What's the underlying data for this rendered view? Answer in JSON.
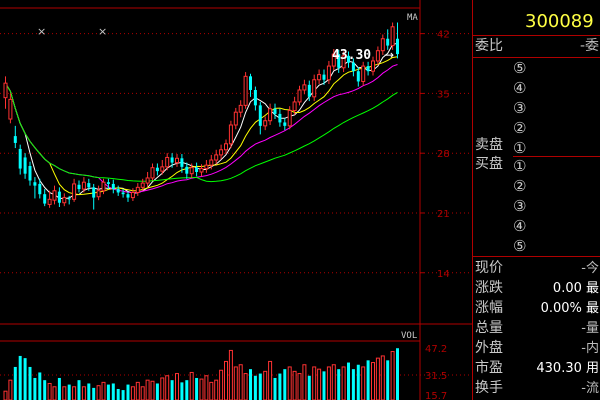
{
  "stock": {
    "code": "300089"
  },
  "main_chart": {
    "ma_label": "MA",
    "price_annotation": "43.30",
    "markers": [
      "×",
      "×"
    ],
    "axis_labels": [
      "42",
      "35",
      "28",
      "21",
      "14"
    ],
    "colors": {
      "up": "#ff3232",
      "down": "#00ffff",
      "ma5": "#ffffff",
      "ma10": "#ffff00",
      "ma20": "#ff00ff",
      "ma60": "#00ff00",
      "grid": "#b00000",
      "text": "#b00000"
    }
  },
  "vol_chart": {
    "label": "VOL",
    "axis_labels": [
      "47.2",
      "31.5",
      "15.7"
    ]
  },
  "side_panel": {
    "wei_bi_label": "委比",
    "wei_bi_value": "-委",
    "sell_label": "卖盘",
    "buy_label": "买盘",
    "sell_levels": [
      "⑤",
      "④",
      "③",
      "②",
      "①"
    ],
    "buy_levels": [
      "①",
      "②",
      "③",
      "④",
      "⑤"
    ],
    "quotes": [
      {
        "label": "现价",
        "value": "-今"
      },
      {
        "label": "涨跌",
        "value": "0.00 最"
      },
      {
        "label": "涨幅",
        "value": "0.00% 最"
      },
      {
        "label": "总量",
        "value": "-量"
      },
      {
        "label": "外盘",
        "value": "-内"
      },
      {
        "label": "市盈",
        "value": "430.30 用"
      },
      {
        "label": "换手",
        "value": "-流"
      }
    ]
  },
  "chart_data": {
    "type": "candlestick",
    "ylim": [
      8,
      45
    ],
    "candles": [
      [
        34.5,
        36.2,
        33.2,
        37.0
      ],
      [
        32.0,
        34.3,
        31.5,
        35.0
      ],
      [
        30.0,
        29.2,
        28.6,
        31.2
      ],
      [
        28.5,
        26.2,
        25.5,
        29.0
      ],
      [
        27.5,
        25.6,
        25.0,
        28.0
      ],
      [
        26.5,
        24.8,
        24.2,
        27.0
      ],
      [
        24.6,
        24.2,
        22.7,
        25.2
      ],
      [
        24.4,
        23.2,
        22.7,
        25.0
      ],
      [
        23.2,
        22.1,
        21.8,
        23.8
      ],
      [
        22.0,
        22.6,
        21.6,
        23.6
      ],
      [
        22.5,
        23.6,
        22.0,
        24.2
      ],
      [
        23.5,
        22.2,
        21.7,
        24.0
      ],
      [
        22.2,
        22.8,
        21.8,
        23.3
      ],
      [
        22.7,
        22.6,
        22.0,
        23.0
      ],
      [
        22.6,
        24.4,
        22.3,
        25.0
      ],
      [
        24.3,
        23.8,
        23.4,
        24.8
      ],
      [
        23.8,
        24.6,
        23.4,
        25.2
      ],
      [
        24.5,
        24.0,
        23.6,
        25.0
      ],
      [
        24.0,
        22.8,
        21.4,
        24.4
      ],
      [
        22.9,
        23.6,
        22.5,
        24.2
      ],
      [
        23.6,
        24.6,
        23.2,
        25.0
      ],
      [
        24.6,
        24.4,
        23.8,
        25.0
      ],
      [
        24.4,
        23.8,
        23.3,
        24.9
      ],
      [
        23.8,
        23.4,
        23.0,
        24.2
      ],
      [
        23.4,
        23.2,
        22.8,
        23.8
      ],
      [
        23.2,
        22.8,
        22.3,
        23.5
      ],
      [
        22.8,
        23.4,
        22.4,
        23.9
      ],
      [
        23.4,
        24.0,
        23.0,
        24.5
      ],
      [
        24.0,
        24.5,
        23.6,
        25.0
      ],
      [
        24.5,
        25.1,
        24.0,
        25.8
      ],
      [
        25.1,
        26.3,
        24.8,
        26.8
      ],
      [
        26.3,
        25.9,
        25.4,
        26.8
      ],
      [
        25.9,
        26.4,
        25.5,
        27.2
      ],
      [
        26.4,
        27.5,
        26.0,
        28.0
      ],
      [
        27.5,
        26.9,
        26.3,
        28.0
      ],
      [
        26.9,
        27.4,
        26.4,
        27.9
      ],
      [
        27.4,
        26.4,
        25.7,
        27.9
      ],
      [
        26.4,
        25.6,
        25.0,
        26.9
      ],
      [
        25.6,
        26.3,
        25.1,
        26.8
      ],
      [
        26.3,
        25.8,
        25.3,
        26.9
      ],
      [
        25.8,
        26.2,
        25.3,
        26.7
      ],
      [
        26.2,
        26.6,
        25.7,
        27.2
      ],
      [
        26.6,
        27.2,
        26.1,
        27.8
      ],
      [
        27.2,
        27.8,
        26.7,
        28.4
      ],
      [
        27.8,
        28.4,
        27.3,
        29.0
      ],
      [
        28.4,
        29.1,
        27.9,
        29.6
      ],
      [
        29.1,
        31.3,
        28.6,
        31.8
      ],
      [
        31.3,
        32.8,
        30.8,
        33.3
      ],
      [
        32.8,
        33.6,
        32.2,
        34.2
      ],
      [
        33.6,
        37.0,
        33.2,
        37.5
      ],
      [
        37.0,
        35.4,
        34.6,
        37.3
      ],
      [
        35.4,
        33.6,
        33.0,
        35.8
      ],
      [
        33.6,
        31.2,
        30.2,
        34.0
      ],
      [
        31.2,
        31.8,
        30.7,
        32.3
      ],
      [
        31.8,
        33.2,
        31.3,
        33.8
      ],
      [
        33.2,
        32.6,
        32.0,
        33.8
      ],
      [
        32.6,
        31.6,
        31.1,
        33.2
      ],
      [
        31.6,
        31.2,
        30.7,
        32.1
      ],
      [
        31.2,
        33.0,
        30.8,
        33.5
      ],
      [
        33.0,
        34.0,
        32.5,
        34.6
      ],
      [
        34.0,
        35.4,
        33.6,
        35.9
      ],
      [
        35.4,
        36.0,
        34.9,
        36.6
      ],
      [
        36.0,
        34.6,
        34.1,
        36.5
      ],
      [
        34.6,
        36.6,
        34.1,
        37.2
      ],
      [
        36.6,
        37.2,
        36.1,
        37.8
      ],
      [
        37.2,
        36.6,
        36.0,
        37.8
      ],
      [
        36.6,
        38.2,
        36.1,
        38.8
      ],
      [
        38.2,
        39.6,
        37.7,
        40.2
      ],
      [
        39.6,
        38.0,
        37.4,
        40.1
      ],
      [
        38.0,
        39.4,
        37.5,
        39.9
      ],
      [
        39.4,
        38.6,
        38.0,
        39.9
      ],
      [
        38.6,
        37.6,
        37.0,
        39.1
      ],
      [
        37.6,
        36.4,
        35.8,
        38.1
      ],
      [
        36.4,
        38.2,
        35.9,
        38.7
      ],
      [
        38.2,
        37.6,
        37.1,
        38.7
      ],
      [
        37.6,
        38.8,
        37.1,
        39.3
      ],
      [
        38.8,
        40.0,
        38.3,
        40.5
      ],
      [
        40.0,
        41.4,
        39.5,
        41.9
      ],
      [
        41.4,
        40.6,
        40.1,
        42.5
      ],
      [
        40.6,
        42.8,
        40.1,
        43.3
      ],
      [
        41.4,
        39.6,
        39.1,
        43.3
      ]
    ],
    "volumes": [
      8,
      18,
      30,
      40,
      38,
      30,
      20,
      25,
      18,
      15,
      12,
      20,
      12,
      14,
      12,
      18,
      12,
      15,
      11,
      13,
      16,
      14,
      15,
      10,
      9,
      14,
      12,
      16,
      12,
      18,
      17,
      15,
      20,
      22,
      18,
      24,
      16,
      18,
      25,
      20,
      19,
      22,
      16,
      18,
      27,
      35,
      45,
      30,
      32,
      24,
      28,
      22,
      24,
      26,
      35,
      20,
      24,
      28,
      30,
      26,
      24,
      32,
      22,
      30,
      28,
      26,
      30,
      32,
      28,
      30,
      34,
      28,
      32,
      30,
      36,
      34,
      38,
      40,
      36,
      44,
      47
    ]
  }
}
